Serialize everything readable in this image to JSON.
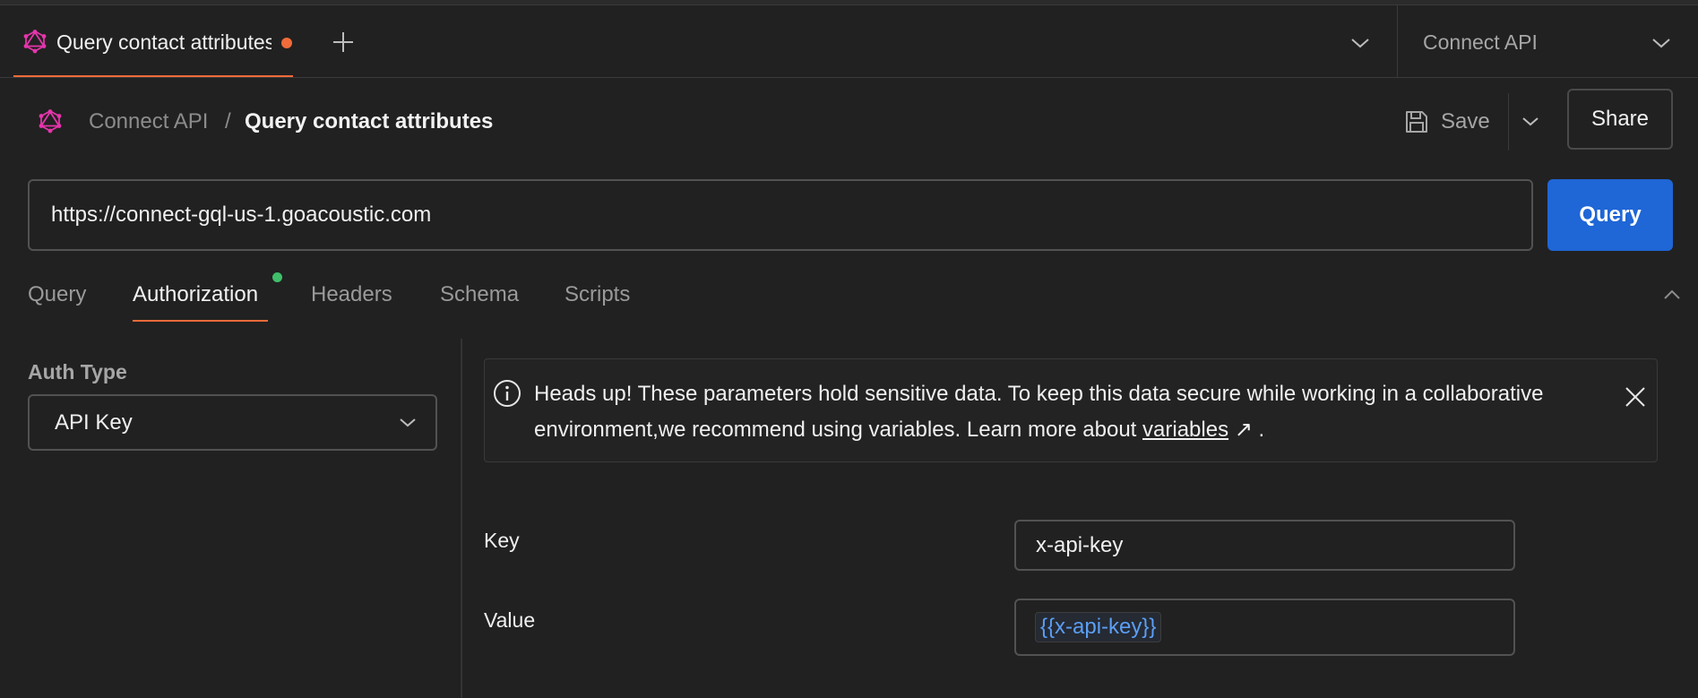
{
  "tab_bar": {
    "active_tab_title": "Query contact attributes",
    "environment": "Connect API"
  },
  "breadcrumb": {
    "parent": "Connect API",
    "separator": "/",
    "current": "Query contact attributes"
  },
  "toolbar": {
    "save_label": "Save",
    "share_label": "Share"
  },
  "request": {
    "url": "https://connect-gql-us-1.goacoustic.com",
    "query_button": "Query"
  },
  "sub_tabs": [
    {
      "label": "Query",
      "active": false
    },
    {
      "label": "Authorization",
      "active": true,
      "indicator": true
    },
    {
      "label": "Headers",
      "active": false
    },
    {
      "label": "Schema",
      "active": false
    },
    {
      "label": "Scripts",
      "active": false
    }
  ],
  "auth": {
    "type_label": "Auth Type",
    "type_value": "API Key"
  },
  "banner": {
    "text_before": "Heads up! These parameters hold sensitive data. To keep this data secure while working in a collaborative environment,we recommend using variables. Learn more about ",
    "link_text": "variables",
    "arrow": "↗",
    "text_after": " ."
  },
  "fields": {
    "key_label": "Key",
    "key_value": "x-api-key",
    "value_label": "Value",
    "value_value": "{{x-api-key}}"
  },
  "colors": {
    "accent_orange": "#f26b3a",
    "primary_blue": "#1f66d6",
    "status_green": "#3fbf6a",
    "graphql_pink": "#e535ab",
    "variable_blue": "#5b9ef5"
  }
}
